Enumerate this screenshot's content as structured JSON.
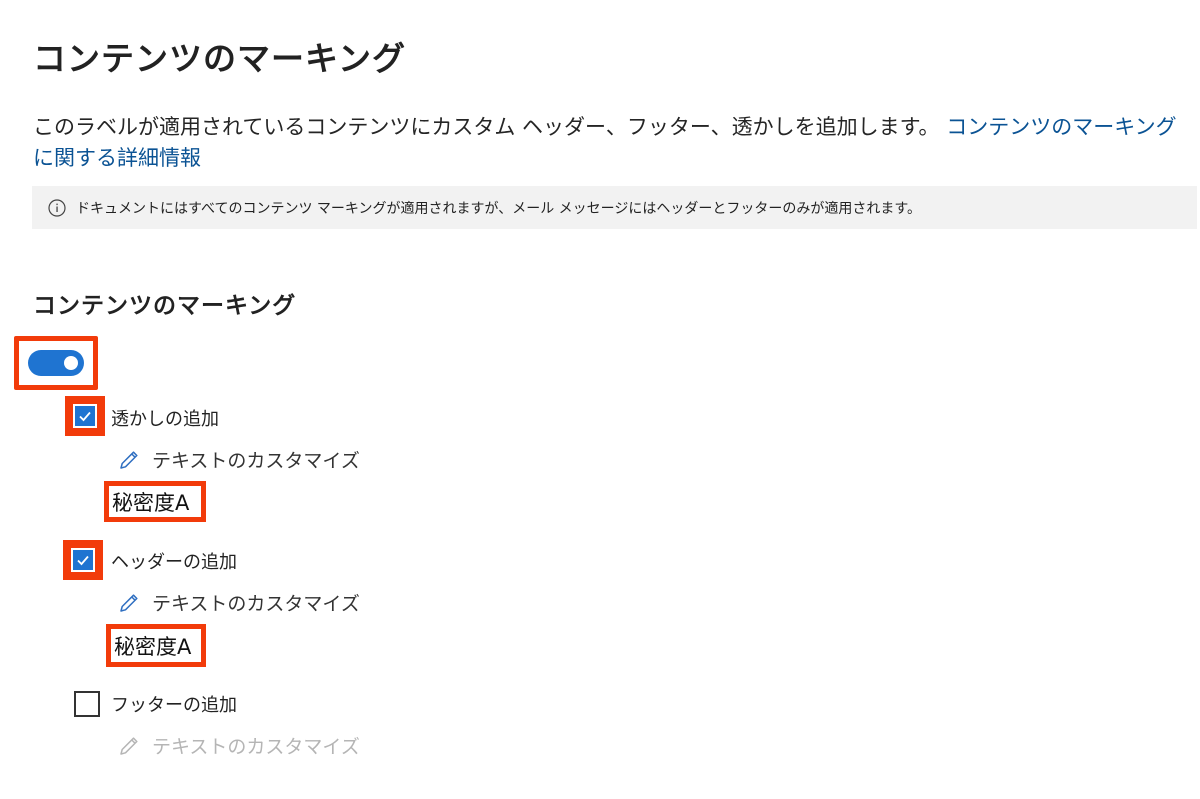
{
  "page": {
    "title": "コンテンツのマーキング",
    "description_text": "このラベルが適用されているコンテンツにカスタム ヘッダー、フッター、透かしを追加します。",
    "description_link": "コンテンツのマーキングに関する詳細情報",
    "info_text": "ドキュメントにはすべてのコンテンツ マーキングが適用されますが、メール メッセージにはヘッダーとフッターのみが適用されます。"
  },
  "section": {
    "title": "コンテンツのマーキング",
    "toggle_on": true
  },
  "options": {
    "watermark": {
      "label": "透かしの追加",
      "checked": true,
      "customize_label": "テキストのカスタマイズ",
      "value": "秘密度A"
    },
    "header": {
      "label": "ヘッダーの追加",
      "checked": true,
      "customize_label": "テキストのカスタマイズ",
      "value": "秘密度A"
    },
    "footer": {
      "label": "フッターの追加",
      "checked": false,
      "customize_label": "テキストのカスタマイズ"
    }
  },
  "icons": {
    "info": "info-circle-icon",
    "edit": "pencil-icon",
    "check": "checkmark-icon"
  },
  "colors": {
    "accent": "#1f74d1",
    "link": "#0b5394",
    "highlight": "#f23b0a",
    "info_bg": "#f2f2f2",
    "disabled_text": "#b5b5b5"
  }
}
